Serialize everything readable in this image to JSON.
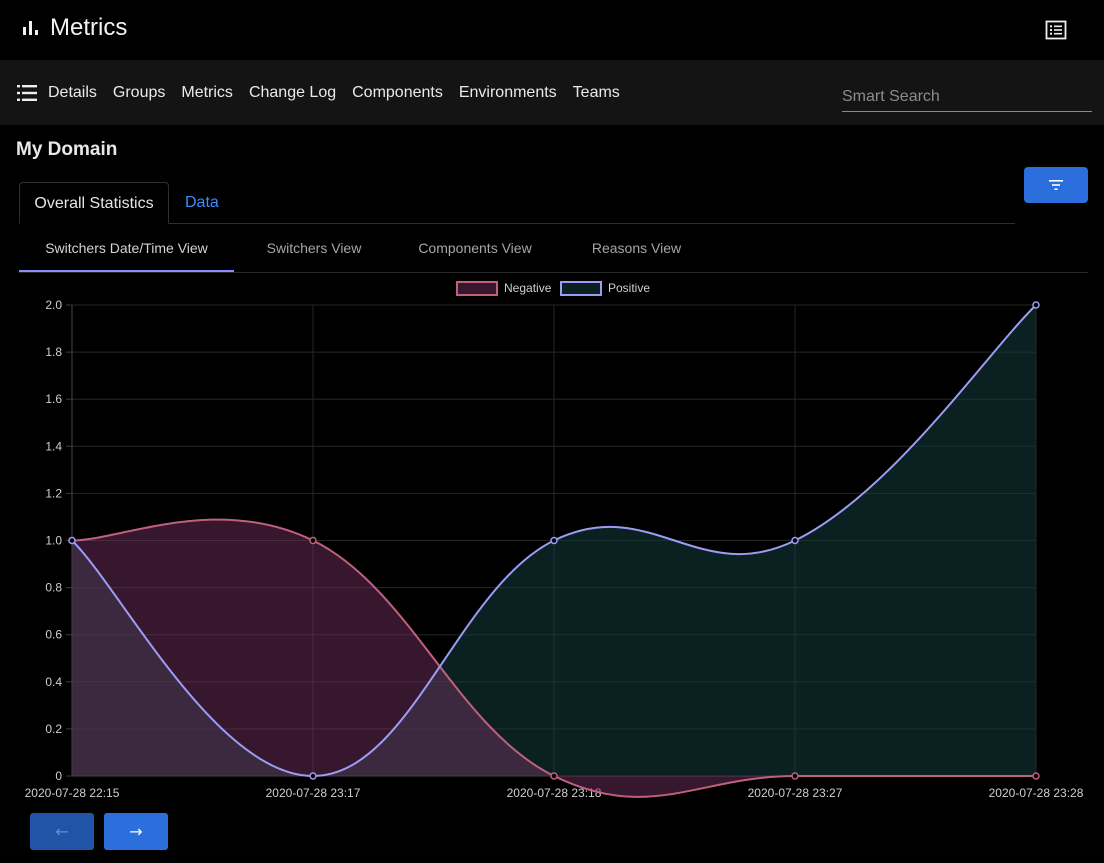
{
  "app": {
    "title": "Metrics"
  },
  "nav": {
    "links": [
      "Details",
      "Groups",
      "Metrics",
      "Change Log",
      "Components",
      "Environments",
      "Teams"
    ],
    "search_placeholder": "Smart Search"
  },
  "page": {
    "title": "My Domain"
  },
  "tabs": [
    {
      "label": "Overall Statistics",
      "active": true
    },
    {
      "label": "Data",
      "active": false
    }
  ],
  "subtabs": [
    {
      "label": "Switchers Date/Time View",
      "active": true
    },
    {
      "label": "Switchers View",
      "active": false
    },
    {
      "label": "Components View",
      "active": false
    },
    {
      "label": "Reasons View",
      "active": false
    }
  ],
  "pager": {
    "prev_arrow": "←",
    "next_arrow": "→",
    "prev_enabled": false
  },
  "icons": {
    "logo": "bar-chart-icon",
    "view_list": "view-list-icon",
    "menu": "menu-list-icon",
    "filter": "filter-icon"
  },
  "colors": {
    "accent": "#2a6fdb",
    "link": "#3d8bfd",
    "negative_line": "#c0607e",
    "negative_fill": "rgba(120,50,100,0.45)",
    "positive_line": "#9c9cf5",
    "positive_fill": "rgba(20,60,60,0.55)"
  },
  "chart_data": {
    "type": "area",
    "categories": [
      "2020-07-28 22:15",
      "2020-07-28 23:17",
      "2020-07-28 23:18",
      "2020-07-28 23:27",
      "2020-07-28 23:28"
    ],
    "series": [
      {
        "name": "Negative",
        "values": [
          1,
          1,
          0,
          0,
          0
        ]
      },
      {
        "name": "Positive",
        "values": [
          1,
          0,
          1,
          1,
          2
        ]
      }
    ],
    "y_ticks": [
      "0",
      "0.2",
      "0.4",
      "0.6",
      "0.8",
      "1.0",
      "1.2",
      "1.4",
      "1.6",
      "1.8",
      "2.0"
    ],
    "ylim": [
      0,
      2
    ],
    "legend": "top-center",
    "grid": true
  }
}
